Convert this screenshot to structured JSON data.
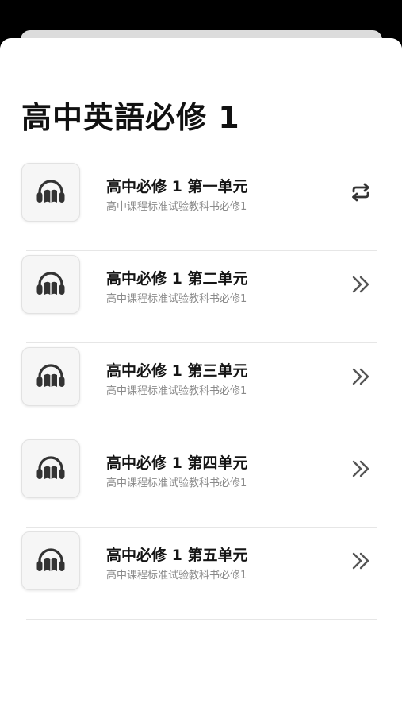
{
  "page": {
    "title": "高中英語必修 1"
  },
  "colors": {
    "icon": "#333333",
    "chevron": "#555555",
    "divider": "#e6e6e6"
  },
  "units": [
    {
      "title": "高中必修 1 第一单元",
      "subtitle": "高中课程标准试验教科书必修1",
      "icon": "headphones-book-icon",
      "action_icon": "repeat-icon"
    },
    {
      "title": "高中必修 1 第二单元",
      "subtitle": "高中课程标准试验教科书必修1",
      "icon": "headphones-book-icon",
      "action_icon": "double-chevron-right-icon"
    },
    {
      "title": "高中必修 1 第三单元",
      "subtitle": "高中课程标准试验教科书必修1",
      "icon": "headphones-book-icon",
      "action_icon": "double-chevron-right-icon"
    },
    {
      "title": "高中必修 1 第四单元",
      "subtitle": "高中课程标准试验教科书必修1",
      "icon": "headphones-book-icon",
      "action_icon": "double-chevron-right-icon"
    },
    {
      "title": "高中必修 1 第五单元",
      "subtitle": "高中课程标准试验教科书必修1",
      "icon": "headphones-book-icon",
      "action_icon": "double-chevron-right-icon"
    }
  ]
}
